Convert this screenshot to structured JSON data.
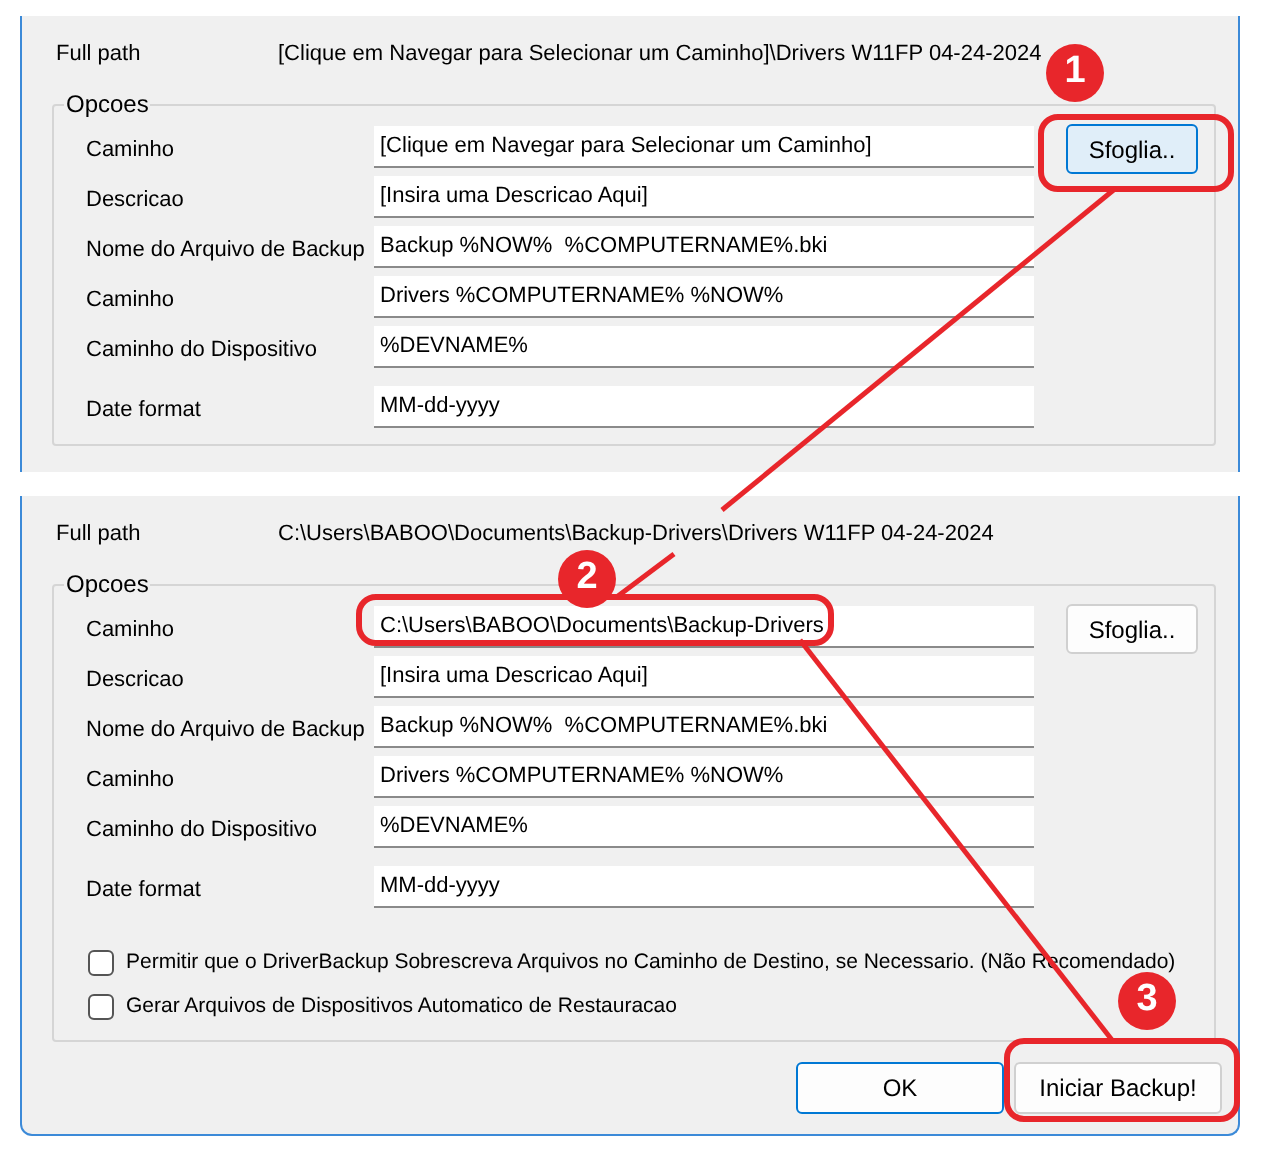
{
  "panels": [
    {
      "full_path_label": "Full path",
      "full_path_value": "[Clique em Navegar para Selecionar um Caminho]\\Drivers W11FP 04-24-2024",
      "group_title": "Opcoes",
      "browse_button": {
        "label": "Sfoglia..",
        "focused": true
      },
      "fields": [
        {
          "label": "Caminho",
          "value": "[Clique em Navegar para Selecionar um Caminho]"
        },
        {
          "label": "Descricao",
          "value": "[Insira uma Descricao Aqui]"
        },
        {
          "label": "Nome do Arquivo de Backup",
          "value": "Backup %NOW%  %COMPUTERNAME%.bki"
        },
        {
          "label": "Caminho",
          "value": "Drivers %COMPUTERNAME% %NOW%"
        },
        {
          "label": "Caminho do Dispositivo",
          "value": "%DEVNAME%"
        },
        {
          "label": "Date format",
          "value": "MM-dd-yyyy"
        }
      ]
    },
    {
      "full_path_label": "Full path",
      "full_path_value": "C:\\Users\\BABOO\\Documents\\Backup-Drivers\\Drivers W11FP 04-24-2024",
      "group_title": "Opcoes",
      "browse_button": {
        "label": "Sfoglia..",
        "focused": false
      },
      "fields": [
        {
          "label": "Caminho",
          "value": "C:\\Users\\BABOO\\Documents\\Backup-Drivers"
        },
        {
          "label": "Descricao",
          "value": "[Insira uma Descricao Aqui]"
        },
        {
          "label": "Nome do Arquivo de Backup",
          "value": "Backup %NOW%  %COMPUTERNAME%.bki"
        },
        {
          "label": "Caminho",
          "value": "Drivers %COMPUTERNAME% %NOW%"
        },
        {
          "label": "Caminho do Dispositivo",
          "value": "%DEVNAME%"
        },
        {
          "label": "Date format",
          "value": "MM-dd-yyyy"
        }
      ],
      "checkboxes": [
        {
          "label": "Permitir que o DriverBackup Sobrescreva Arquivos no Caminho de Destino, se Necessario. (Não Recomendado)",
          "checked": false
        },
        {
          "label": "Gerar Arquivos de Dispositivos Automatico de Restauracao",
          "checked": false
        }
      ],
      "buttons": [
        {
          "label": "OK",
          "default": true
        },
        {
          "label": "Iniciar Backup!",
          "default": false
        }
      ]
    }
  ],
  "step_badges": [
    "1",
    "2",
    "3"
  ]
}
